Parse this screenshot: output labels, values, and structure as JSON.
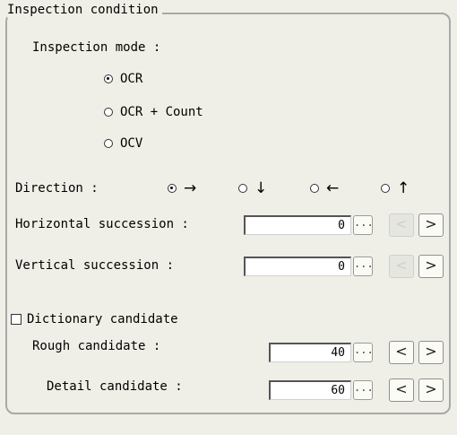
{
  "group_title": "Inspection condition",
  "inspection_mode": {
    "label": "Inspection mode :",
    "options": [
      "OCR",
      "OCR + Count",
      "OCV"
    ],
    "selected": "OCR"
  },
  "direction": {
    "label": "Direction :",
    "options": [
      "→",
      "↓",
      "←",
      "↑"
    ],
    "selected": "→"
  },
  "horizontal_succession": {
    "label": "Horizontal succession :",
    "value": "0",
    "more": "...",
    "prev": "<",
    "next": ">"
  },
  "vertical_succession": {
    "label": "Vertical succession :",
    "value": "0",
    "more": "...",
    "prev": "<",
    "next": ">"
  },
  "dictionary_candidate": {
    "label": "Dictionary candidate",
    "checked": false,
    "rough": {
      "label": "Rough candidate :",
      "value": "40",
      "more": "...",
      "prev": "<",
      "next": ">"
    },
    "detail": {
      "label": "Detail candidate :",
      "value": "60",
      "more": "...",
      "prev": "<",
      "next": ">"
    }
  }
}
